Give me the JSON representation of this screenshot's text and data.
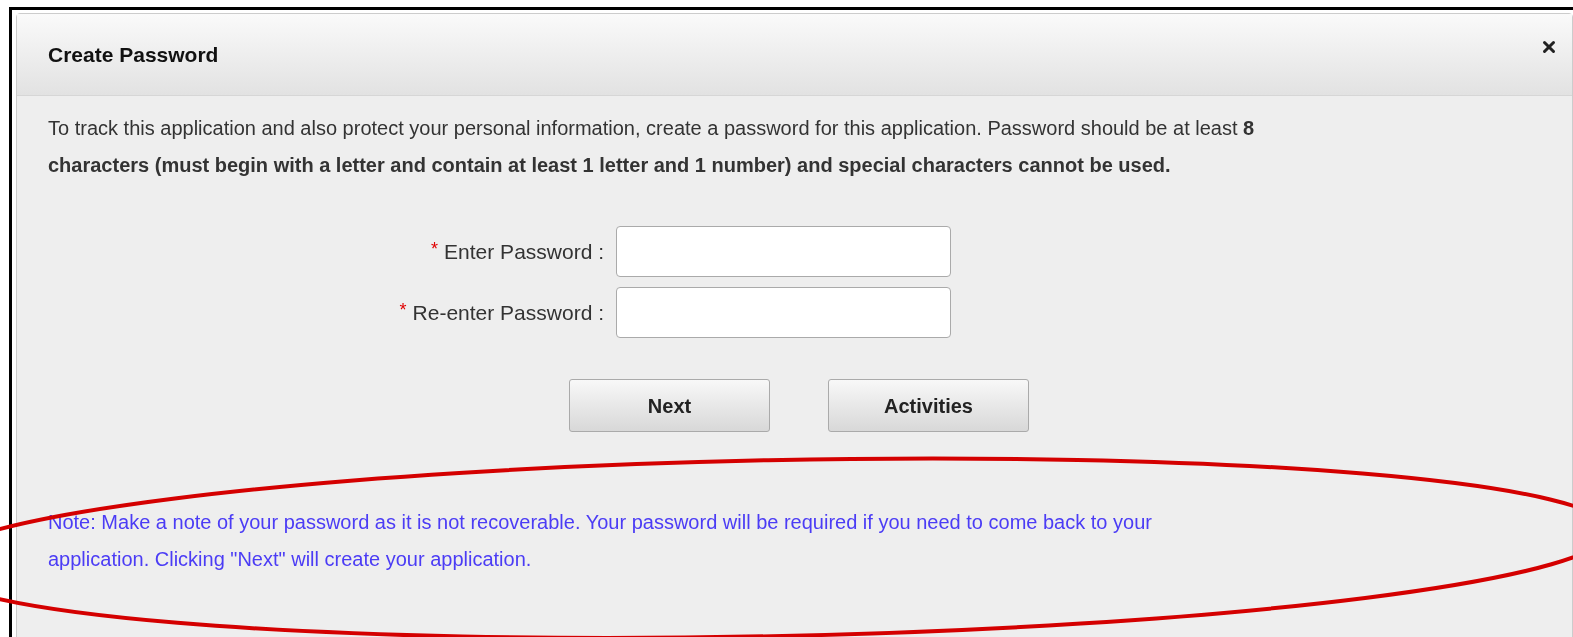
{
  "dialog": {
    "title": "Create Password",
    "intro": "To track this application and also protect your personal information, create a password for this application. Password should be at least **8 characters (must begin with a letter and contain at least 1 letter and 1 number) and special characters cannot be used.**",
    "fields": [
      {
        "marker": "*",
        "label": "Enter Password :"
      },
      {
        "marker": "*",
        "label": "Re-enter Password :"
      }
    ],
    "buttons": [
      "Next",
      "Activities"
    ],
    "note": "Note: Make a note of your password as it is not recoverable. Your password will be required if you need to come back to your application. Clicking \"Next\" will create your application."
  }
}
